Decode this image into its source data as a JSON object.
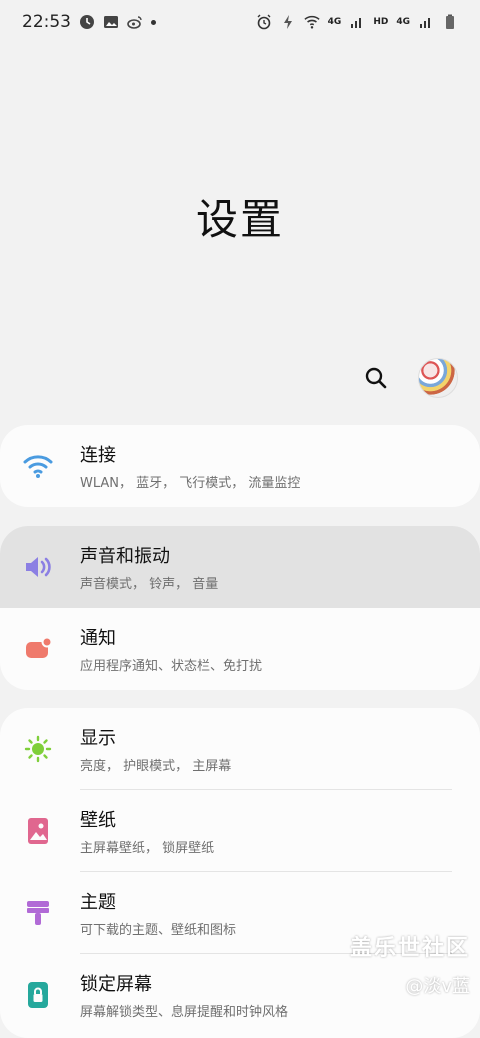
{
  "status_bar": {
    "time": "22:53",
    "left_icons": [
      "clock-badge-icon",
      "gallery-icon",
      "weibo-icon",
      "dot-icon"
    ],
    "right_icons": [
      "alarm-icon",
      "nfc-icon",
      "wifi-icon",
      "4g-signal-icon",
      "hd-icon",
      "4g-signal-icon",
      "battery-icon"
    ],
    "net_label_1": "4G",
    "hd_label": "HD",
    "net_label_2": "4G"
  },
  "header": {
    "title": "设置"
  },
  "tools": {
    "search_icon": "search-icon",
    "avatar": "avatar"
  },
  "groups": [
    {
      "items": [
        {
          "title": "连接",
          "subtitle": "WLAN， 蓝牙， 飞行模式， 流量监控",
          "icon": "wifi-icon",
          "color": "#4a9be0"
        }
      ]
    },
    {
      "items": [
        {
          "title": "声音和振动",
          "subtitle": "声音模式， 铃声， 音量",
          "icon": "volume-icon",
          "color": "#8b7fe3"
        },
        {
          "title": "通知",
          "subtitle": "应用程序通知、状态栏、免打扰",
          "icon": "notification-icon",
          "color": "#ef7a6c"
        }
      ]
    },
    {
      "items": [
        {
          "title": "显示",
          "subtitle": "亮度， 护眼模式， 主屏幕",
          "icon": "sun-icon",
          "color": "#7fcf3a"
        },
        {
          "title": "壁纸",
          "subtitle": "主屏幕壁纸， 锁屏壁纸",
          "icon": "wallpaper-icon",
          "color": "#e0678f"
        },
        {
          "title": "主题",
          "subtitle": "可下载的主题、壁纸和图标",
          "icon": "theme-brush-icon",
          "color": "#b16ad6"
        },
        {
          "title": "锁定屏幕",
          "subtitle": "屏幕解锁类型、息屏提醒和时钟风格",
          "icon": "lock-icon",
          "color": "#25a89c"
        }
      ]
    }
  ],
  "watermark": {
    "line1": "盖乐世社区",
    "line2": "@淡v蓝"
  }
}
